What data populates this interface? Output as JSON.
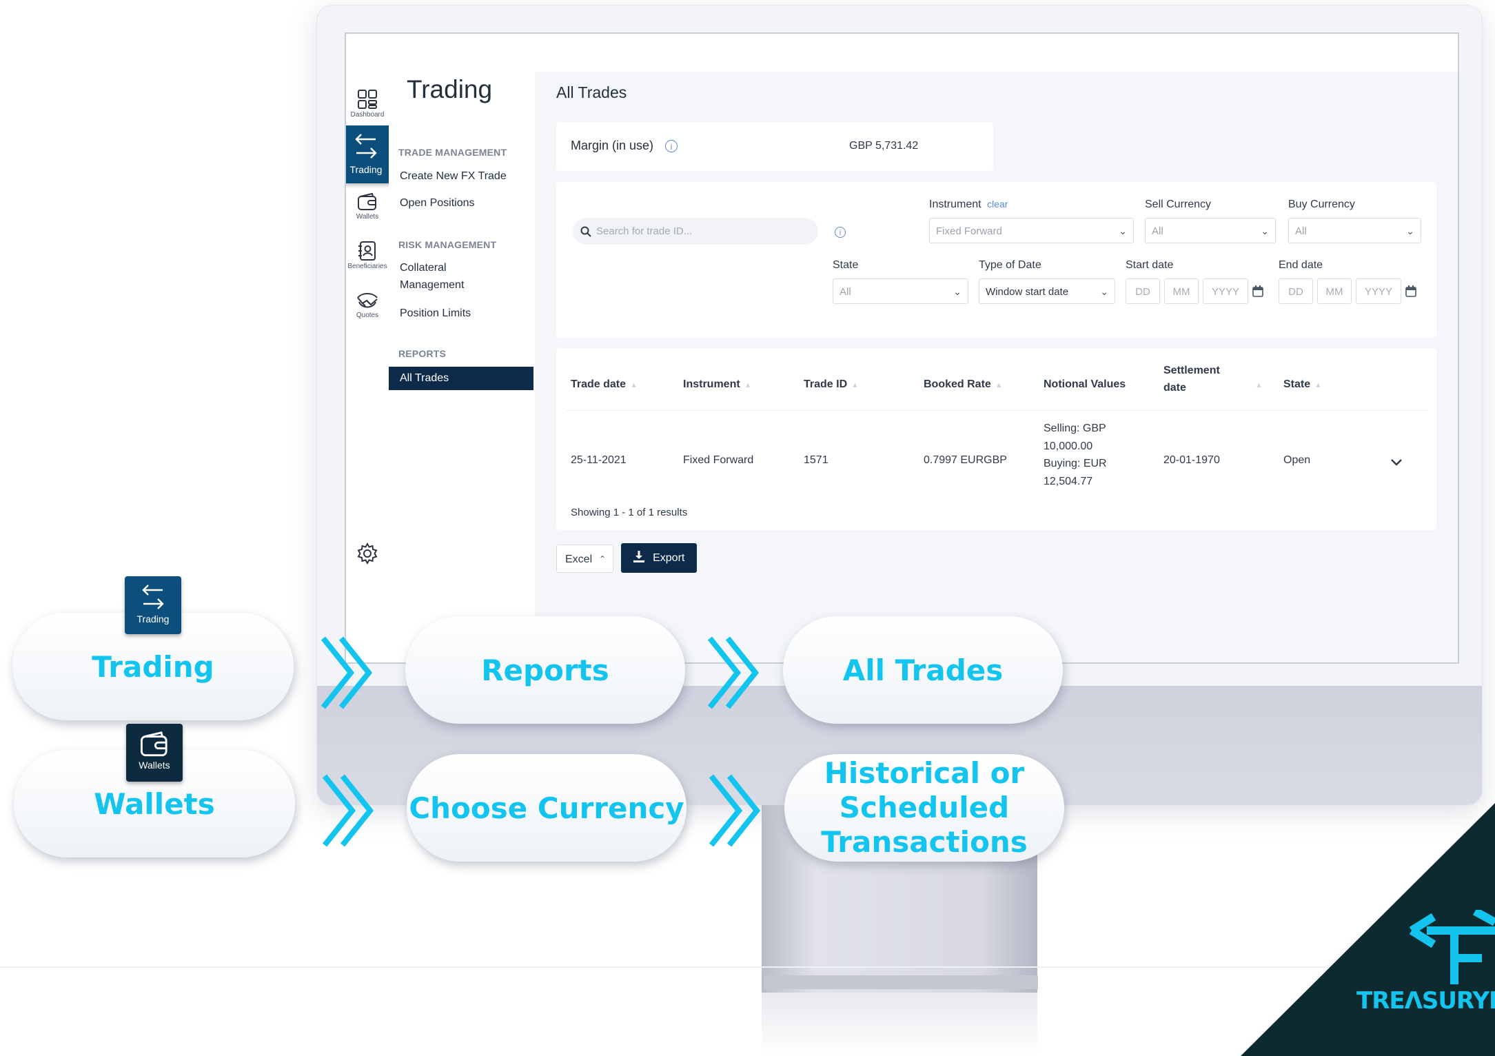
{
  "nav": {
    "rail": [
      {
        "label": "Dashboard",
        "icon": "dashboard-icon"
      },
      {
        "label": "Trading",
        "icon": "arrows-icon"
      },
      {
        "label": "Wallets",
        "icon": "wallet-icon"
      },
      {
        "label": "Beneficiaries",
        "icon": "contacts-icon"
      },
      {
        "label": "Quotes",
        "icon": "handshake-icon"
      }
    ],
    "title": "Trading",
    "sections": [
      {
        "heading": "TRADE MANAGEMENT",
        "items": [
          "Create New FX Trade",
          "Open Positions"
        ]
      },
      {
        "heading": "RISK MANAGEMENT",
        "items": [
          "Collateral",
          "Management",
          "Position Limits"
        ]
      },
      {
        "heading": "REPORTS",
        "items": [
          "All Trades"
        ]
      }
    ]
  },
  "main": {
    "title": "All Trades",
    "margin": {
      "label": "Margin (in use)",
      "value": "GBP 5,731.42"
    },
    "filters": {
      "search_placeholder": "Search for  trade ID...",
      "instrument_label": "Instrument",
      "instrument_clear": "clear",
      "instrument_value": "Fixed Forward",
      "sell_currency_label": "Sell Currency",
      "sell_currency_value": "All",
      "buy_currency_label": "Buy Currency",
      "buy_currency_value": "All",
      "state_label": "State",
      "state_value": "All",
      "type_of_date_label": "Type of Date",
      "type_of_date_value": "Window start date",
      "start_date_label": "Start date",
      "end_date_label": "End date",
      "dd": "DD",
      "mm": "MM",
      "yyyy": "YYYY"
    },
    "table": {
      "headers": [
        "Trade date",
        "Instrument",
        "Trade ID",
        "Booked Rate",
        "Notional Values",
        "Settlement",
        "date",
        "State"
      ],
      "row": {
        "trade_date": "25-11-2021",
        "instrument": "Fixed Forward",
        "trade_id": "1571",
        "booked_rate": "0.7997 EURGBP",
        "notional": [
          "Selling: GBP",
          "10,000.00",
          "Buying: EUR",
          "12,504.77"
        ],
        "settlement_date": "20-01-1970",
        "state": "Open"
      },
      "results": "Showing 1 - 1 of 1 results"
    },
    "export": {
      "format": "Excel",
      "button": "Export"
    }
  },
  "flow": {
    "row1": [
      "Trading",
      "Reports",
      "All Trades"
    ],
    "row2": [
      "Wallets",
      "Choose Currency",
      "Historical or",
      "Scheduled",
      "Transactions"
    ],
    "badge1": "Trading",
    "badge2": "Wallets"
  },
  "logo": {
    "text": "TREΛSURYF"
  },
  "colors": {
    "accent": "#13c4ef",
    "navy": "#0d2a4a",
    "active_blue": "#0c4f7c"
  }
}
